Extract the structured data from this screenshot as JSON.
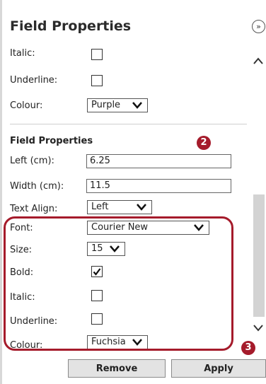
{
  "header": {
    "title": "Field Properties",
    "collapse_glyph": "»"
  },
  "top": {
    "italic_label": "Italic:",
    "underline_label": "Underline:",
    "colour_label": "Colour:",
    "colour_value": "Purple"
  },
  "section": {
    "title": "Field Properties",
    "marker": "2",
    "left_label": "Left (cm):",
    "left_value": "6.25",
    "width_label": "Width (cm):",
    "width_value": "11.5",
    "align_label": "Text Align:",
    "align_value": "Left",
    "font_label": "Font:",
    "font_value": "Courier New",
    "size_label": "Size:",
    "size_value": "15",
    "bold_label": "Bold:",
    "bold_checked": true,
    "italic_label": "Italic:",
    "underline_label": "Underline:",
    "colour_label": "Colour:",
    "colour_value": "Fuchsia"
  },
  "marker3": "3",
  "buttons": {
    "remove": "Remove",
    "apply": "Apply"
  },
  "colors": {
    "accent": "#a51b2b",
    "button_bg": "#e3e3e3",
    "scroll_track": "#d3d3d3"
  },
  "icons": [
    "collapse-icon",
    "chevron-down-icon",
    "scroll-up-icon",
    "scroll-down-icon",
    "check-icon"
  ]
}
